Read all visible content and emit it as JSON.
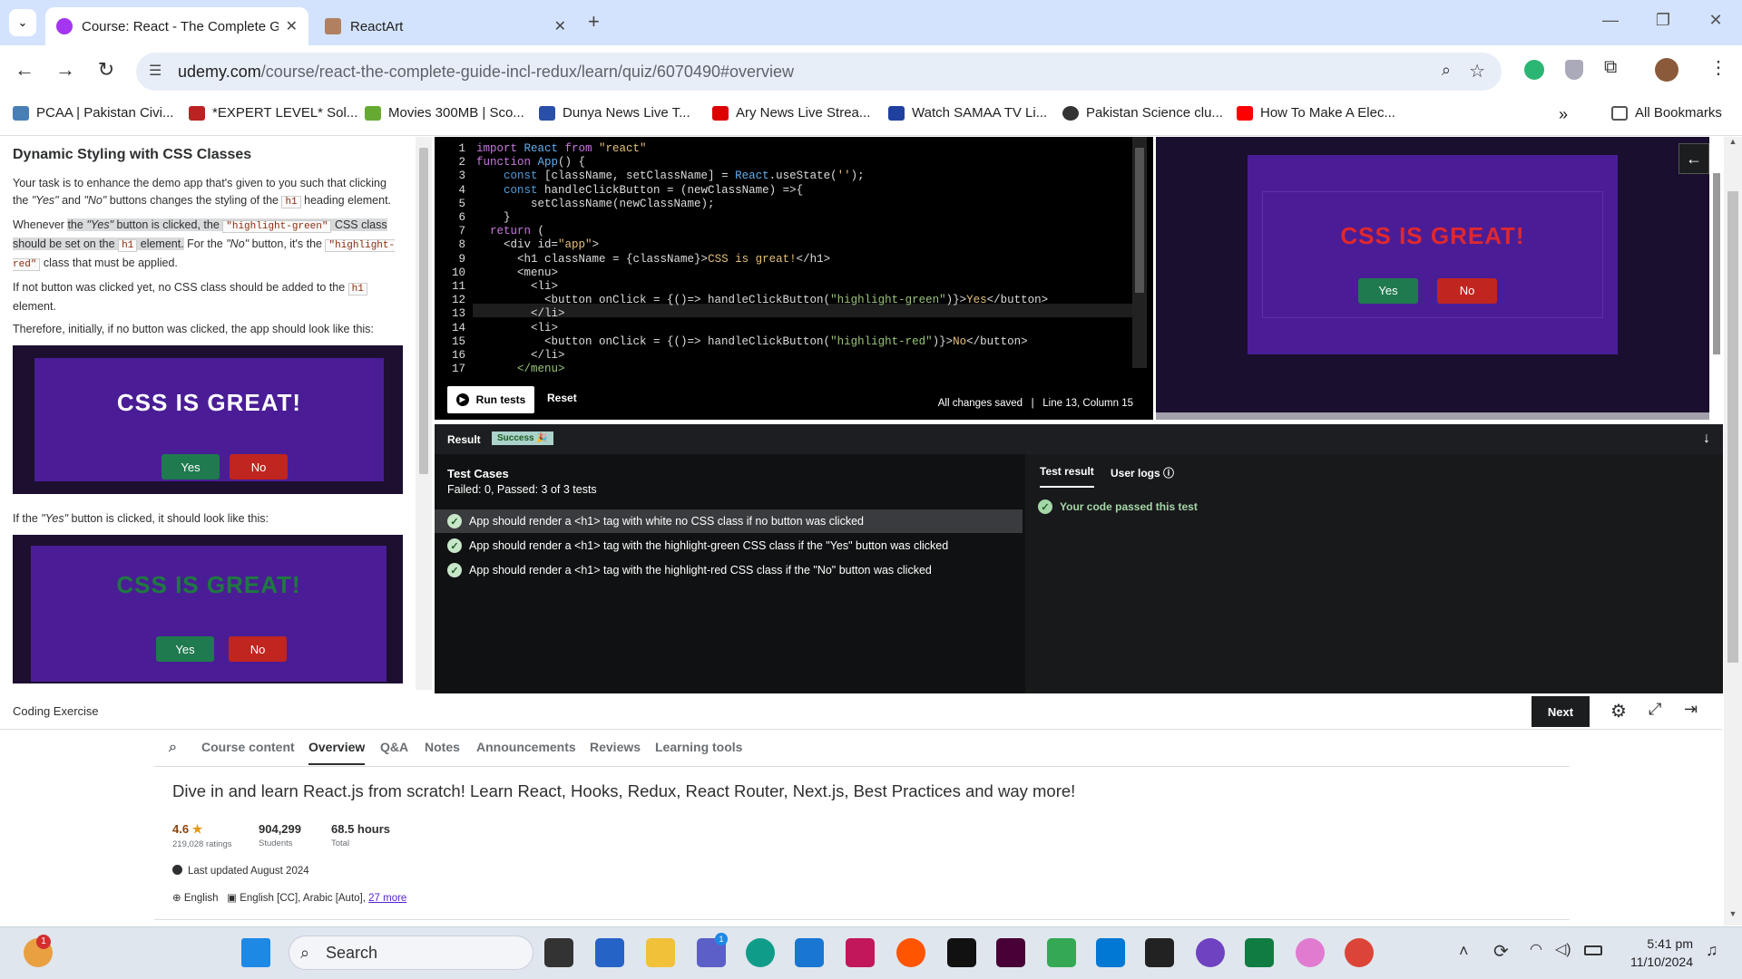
{
  "browser": {
    "tabs": [
      {
        "title": "Course: React - The Complete Guide",
        "active": true
      },
      {
        "title": "ReactArt",
        "active": false
      }
    ],
    "url_domain": "udemy.com",
    "url_path": "/course/react-the-complete-guide-incl-redux/learn/quiz/6070490#overview",
    "bookmarks": [
      "PCAA | Pakistan Civi...",
      "*EXPERT LEVEL* Sol...",
      "Movies 300MB | Sco...",
      "Dunya News Live T...",
      "Ary News Live Strea...",
      "Watch SAMAA TV Li...",
      "Pakistan Science clu...",
      "How To Make A Elec..."
    ],
    "all_bookmarks": "All Bookmarks"
  },
  "instructions": {
    "title": "Dynamic Styling with CSS Classes",
    "p1_a": "Your task is to enhance the demo app that's given to you such that clicking the ",
    "p1_yes": "\"Yes\"",
    "p1_and": " and ",
    "p1_no": "\"No\"",
    "p1_b": " buttons changes the styling of the ",
    "p1_code": "h1",
    "p1_c": " heading element.",
    "p2_a": "Whenever ",
    "p2_b": "the ",
    "p2_yes": "\"Yes\"",
    "p2_c": " button is clicked, the ",
    "p2_code1": "\"highlight-green\"",
    "p2_d": " CSS class should be set on the ",
    "p2_code2": "h1",
    "p2_e": " element.",
    "p2_f": " For the ",
    "p2_no": "\"No\"",
    "p2_g": " button, it's the ",
    "p2_code3": "\"highlight-red\"",
    "p2_h": " class that must be applied.",
    "p3_a": "If not button was clicked yet, no CSS class should be added to the ",
    "p3_code": "h1",
    "p3_b": " element.",
    "p4": "Therefore, initially, if no button was clicked, the app should look like this:",
    "p5_a": "If the ",
    "p5_yes": "\"Yes\"",
    "p5_b": " button is clicked, it should look like this:",
    "demo_title": "CSS IS GREAT!",
    "yes": "Yes",
    "no": "No",
    "colors": {
      "white": "#ffffff",
      "green": "#1e7a3f",
      "red": "#e0282e"
    }
  },
  "editor": {
    "lines": [
      "1",
      "2",
      "3",
      "4",
      "5",
      "6",
      "7",
      "8",
      "9",
      "10",
      "11",
      "12",
      "13",
      "14",
      "15",
      "16",
      "17"
    ],
    "run_label": "Run tests",
    "reset_label": "Reset",
    "status": "All changes saved",
    "sep": "|",
    "position": "Line 13, Column 15"
  },
  "results": {
    "result_label": "Result",
    "badge": "Success 🎉",
    "tc_title": "Test Cases",
    "tc_summary": "Failed: 0, Passed: 3 of 3 tests",
    "tests": [
      "App should render a <h1> tag with white no CSS class if no button was clicked",
      "App should render a <h1> tag with the highlight-green CSS class if the \"Yes\" button was clicked",
      "App should render a <h1> tag with the highlight-red CSS class if the \"No\" button was clicked"
    ],
    "tab_result": "Test result",
    "tab_logs": "User logs",
    "passed": "Your code passed this test"
  },
  "bottom": {
    "label": "Coding Exercise",
    "next": "Next"
  },
  "course": {
    "tabs": [
      "Course content",
      "Overview",
      "Q&A",
      "Notes",
      "Announcements",
      "Reviews",
      "Learning tools"
    ],
    "headline": "Dive in and learn React.js from scratch! Learn React, Hooks, Redux, React Router, Next.js, Best Practices and way more!",
    "rating": "4.6",
    "ratings_count": "219,028 ratings",
    "students": "904,299",
    "students_label": "Students",
    "hours": "68.5 hours",
    "hours_label": "Total",
    "updated": "Last updated August 2024",
    "lang": "English",
    "captions": "English [CC], Arabic [Auto],",
    "more": "27 more"
  },
  "taskbar": {
    "search": "Search",
    "time": "5:41 pm",
    "date": "11/10/2024",
    "badge1": "1",
    "badge2": "1"
  }
}
